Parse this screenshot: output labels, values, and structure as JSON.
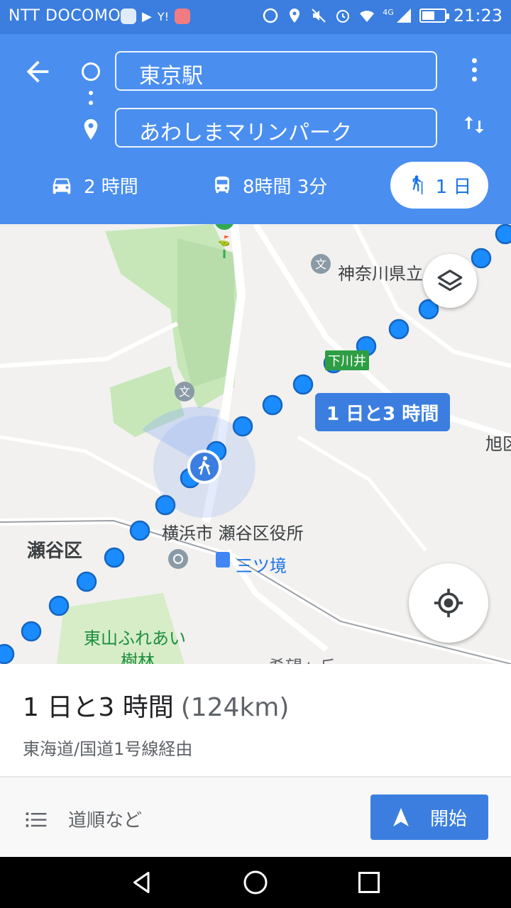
{
  "status_bar": {
    "carrier": "NTT DOCOMO",
    "time": "21:23",
    "network": "4G",
    "battery_level": 0.55,
    "icons": [
      "line-icon",
      "play-icon",
      "yahoo-icon",
      "mail-icon",
      "data-saver-icon",
      "location-icon",
      "mute-icon",
      "alarm-icon",
      "wifi-icon",
      "signal-icon",
      "battery-icon"
    ]
  },
  "header": {
    "origin": "東京駅",
    "destination": "あわしまマリンパーク",
    "modes": [
      {
        "name": "car",
        "label": "2 時間"
      },
      {
        "name": "transit",
        "label": "8時間 3分"
      },
      {
        "name": "walk",
        "label": "1 日",
        "selected": true
      }
    ]
  },
  "map": {
    "labels": {
      "kanagawa": "神奈川県立",
      "shimokawai": "下川井",
      "asahi": "旭区",
      "seya_office": "横浜市 瀬谷区役所",
      "seya_ward": "瀬谷区",
      "mitsukyo": "三ツ境",
      "higashiyama": "東山ふれあい",
      "forest": "樹林",
      "kibogaoka": "希望ヶ丘"
    },
    "route_duration_tip": "1 日と3 時間",
    "route_color": "#1a8cff"
  },
  "sheet": {
    "duration": "1 日と3 時間",
    "distance": "(124km)",
    "via": "東海道/国道1号線経由",
    "steps_label": "道順など",
    "start_label": "開始"
  },
  "colors": {
    "header_blue": "#4a8ef0",
    "status_blue": "#3b7ee0",
    "accent": "#1a73e8"
  }
}
